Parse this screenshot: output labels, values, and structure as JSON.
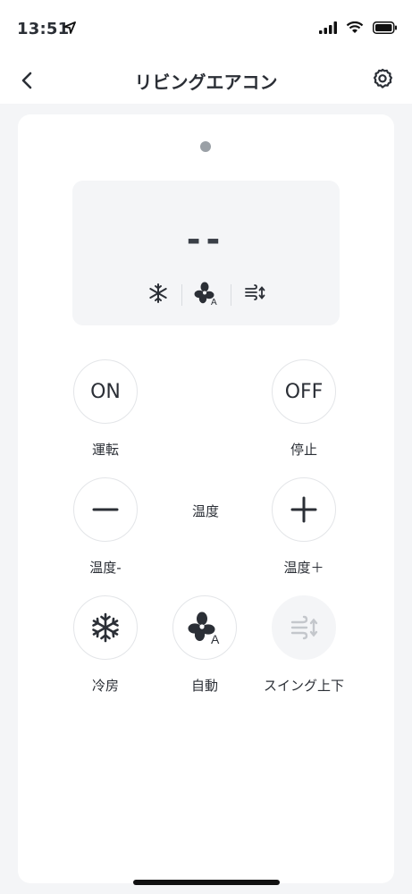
{
  "status_bar": {
    "time": "13:51",
    "icons": [
      "location-arrow-icon",
      "cellular-signal-icon",
      "wifi-icon",
      "battery-icon"
    ]
  },
  "header": {
    "title": "リビングエアコン",
    "back_icon": "chevron-left-icon",
    "settings_icon": "gear-icon"
  },
  "display": {
    "temperature": "--",
    "mode_icons": [
      "snowflake-icon",
      "fan-auto-icon",
      "swing-icon"
    ]
  },
  "controls": {
    "on": {
      "text": "ON",
      "label": "運転"
    },
    "off": {
      "text": "OFF",
      "label": "停止"
    },
    "temp_down": {
      "label": "温度-"
    },
    "temp_center_label": "温度",
    "temp_up": {
      "label": "温度＋"
    },
    "cool": {
      "label": "冷房"
    },
    "auto": {
      "label": "自動"
    },
    "swing": {
      "label": "スイング上下"
    }
  },
  "colors": {
    "background": "#f4f5f7",
    "card": "#ffffff",
    "text": "#2b2f36",
    "disabled": "#c4c7cc"
  }
}
